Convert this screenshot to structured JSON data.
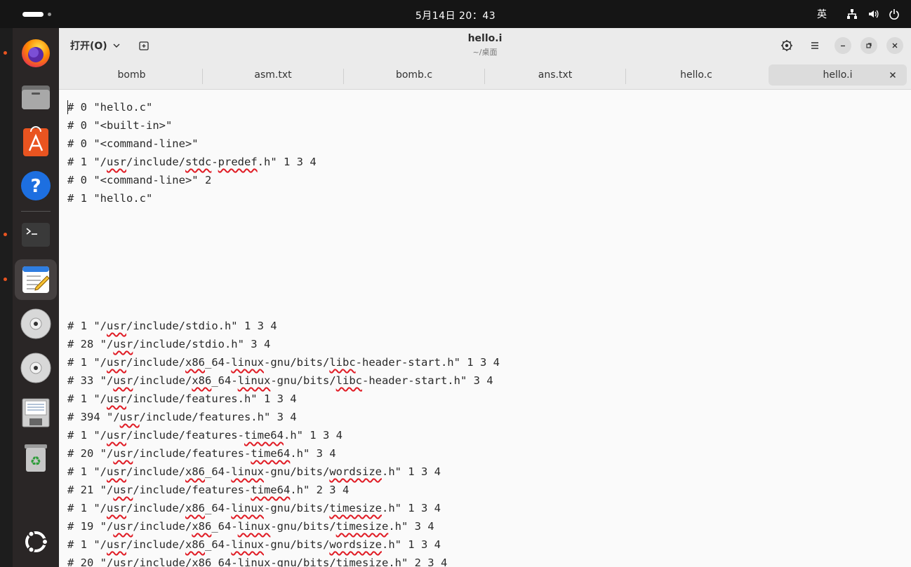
{
  "topbar": {
    "clock": "5月14日  20：43",
    "input_method": "英"
  },
  "dock": {
    "items": [
      {
        "name": "firefox",
        "running": true
      },
      {
        "name": "files",
        "running": false
      },
      {
        "name": "app-center",
        "running": false
      },
      {
        "name": "help",
        "running": false
      },
      {
        "name": "terminal",
        "running": true
      },
      {
        "name": "text-editor",
        "running": true
      },
      {
        "name": "disc-1",
        "running": false
      },
      {
        "name": "disc-2",
        "running": false
      },
      {
        "name": "save-drive",
        "running": false
      },
      {
        "name": "trash",
        "running": false
      },
      {
        "name": "show-apps",
        "running": false
      }
    ]
  },
  "headerbar": {
    "open_label": "打开(O)",
    "title": "hello.i",
    "subtitle": "~/桌面"
  },
  "tabs": [
    {
      "label": "bomb",
      "active": false
    },
    {
      "label": "asm.txt",
      "active": false
    },
    {
      "label": "bomb.c",
      "active": false
    },
    {
      "label": "ans.txt",
      "active": false
    },
    {
      "label": "hello.c",
      "active": false
    },
    {
      "label": "hello.i",
      "active": true
    }
  ],
  "editor": {
    "lines": [
      "# 0 \"hello.c\"",
      "# 0 \"<built-in>\"",
      "# 0 \"<command-line>\"",
      "# 1 \"/usr/include/stdc-predef.h\" 1 3 4",
      "# 0 \"<command-line>\" 2",
      "# 1 \"hello.c\"",
      "",
      "",
      "",
      "",
      "",
      "",
      "# 1 \"/usr/include/stdio.h\" 1 3 4",
      "# 28 \"/usr/include/stdio.h\" 3 4",
      "# 1 \"/usr/include/x86_64-linux-gnu/bits/libc-header-start.h\" 1 3 4",
      "# 33 \"/usr/include/x86_64-linux-gnu/bits/libc-header-start.h\" 3 4",
      "# 1 \"/usr/include/features.h\" 1 3 4",
      "# 394 \"/usr/include/features.h\" 3 4",
      "# 1 \"/usr/include/features-time64.h\" 1 3 4",
      "# 20 \"/usr/include/features-time64.h\" 3 4",
      "# 1 \"/usr/include/x86_64-linux-gnu/bits/wordsize.h\" 1 3 4",
      "# 21 \"/usr/include/features-time64.h\" 2 3 4",
      "# 1 \"/usr/include/x86_64-linux-gnu/bits/timesize.h\" 1 3 4",
      "# 19 \"/usr/include/x86_64-linux-gnu/bits/timesize.h\" 3 4",
      "# 1 \"/usr/include/x86_64-linux-gnu/bits/wordsize.h\" 1 3 4",
      "# 20 \"/usr/include/x86_64-linux-gnu/bits/timesize.h\" 2 3 4"
    ],
    "misspelled_words": [
      "usr",
      "stdc",
      "predef",
      "x86",
      "linux",
      "libc",
      "time64",
      "wordsize",
      "timesize"
    ]
  },
  "colors": {
    "accent": "#e95420",
    "spell_error": "#e01b24"
  }
}
